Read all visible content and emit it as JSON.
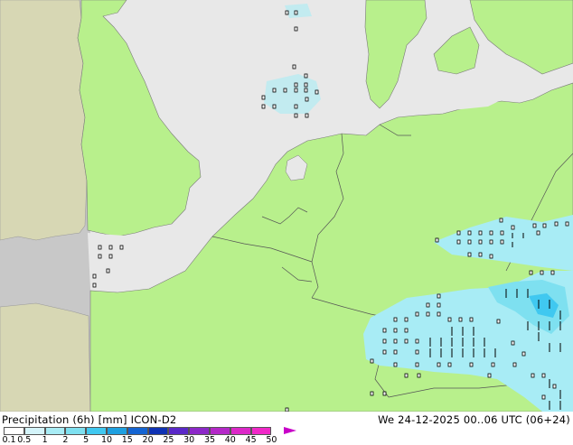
{
  "header": {
    "title": "Precipitation (6h) [mm] ICON-D2",
    "valid_time": "We 24-12-2025 00..06 UTC (06+24)"
  },
  "legend": {
    "labels": [
      "0.1",
      "0.5",
      "1",
      "2",
      "5",
      "10",
      "15",
      "20",
      "25",
      "30",
      "35",
      "40",
      "45",
      "50"
    ],
    "colors": [
      "#ffffff",
      "#d4f4fa",
      "#a8ecf5",
      "#7ee0f0",
      "#40c8f0",
      "#1ea0e0",
      "#1464d2",
      "#0f32b4",
      "#5a28c8",
      "#8c28c8",
      "#b428c8",
      "#dc28c8",
      "#f028c8"
    ],
    "arrow_color": "#c800c8"
  },
  "map_colors": {
    "sea": "#e8e8e8",
    "land": "#b8f08c",
    "outside_domain": "#c8c8c8",
    "outside_land": "#d7d7b4",
    "border": "#7a7a7a",
    "precip_light": "#a8ecf5",
    "precip_mid": "#40c8f0"
  }
}
